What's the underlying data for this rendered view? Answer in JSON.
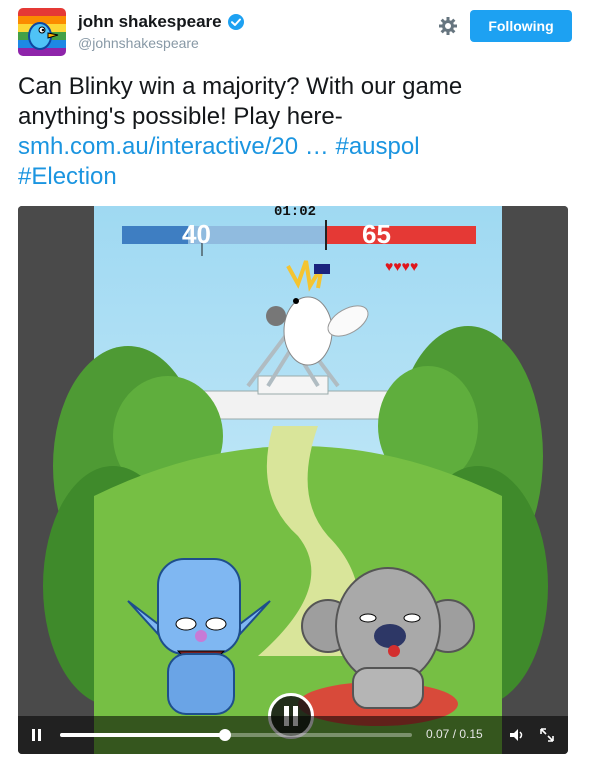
{
  "author": {
    "display_name": "john shakespeare",
    "handle": "@johnshakespeare",
    "verified": true,
    "avatar_icon": "bird-avatar-icon"
  },
  "actions": {
    "settings_icon": "gear-icon",
    "follow_label": "Following",
    "follow_color": "#1da1f2"
  },
  "tweet": {
    "text_line1": "Can Blinky win a majority? With our game",
    "text_line2": "anything's possible! Play here-",
    "link_text": "smh.com.au/interactive/20 …",
    "hashtag1": "#auspol",
    "hashtag2": "#Election",
    "link_color": "#1b95e0"
  },
  "video": {
    "game_timer": "01:02",
    "score_left": "40",
    "score_right": "65",
    "hearts": "♥♥♥♥",
    "time_readout": "0.07 / 0.15",
    "progress": 0.47,
    "state": "playing"
  }
}
